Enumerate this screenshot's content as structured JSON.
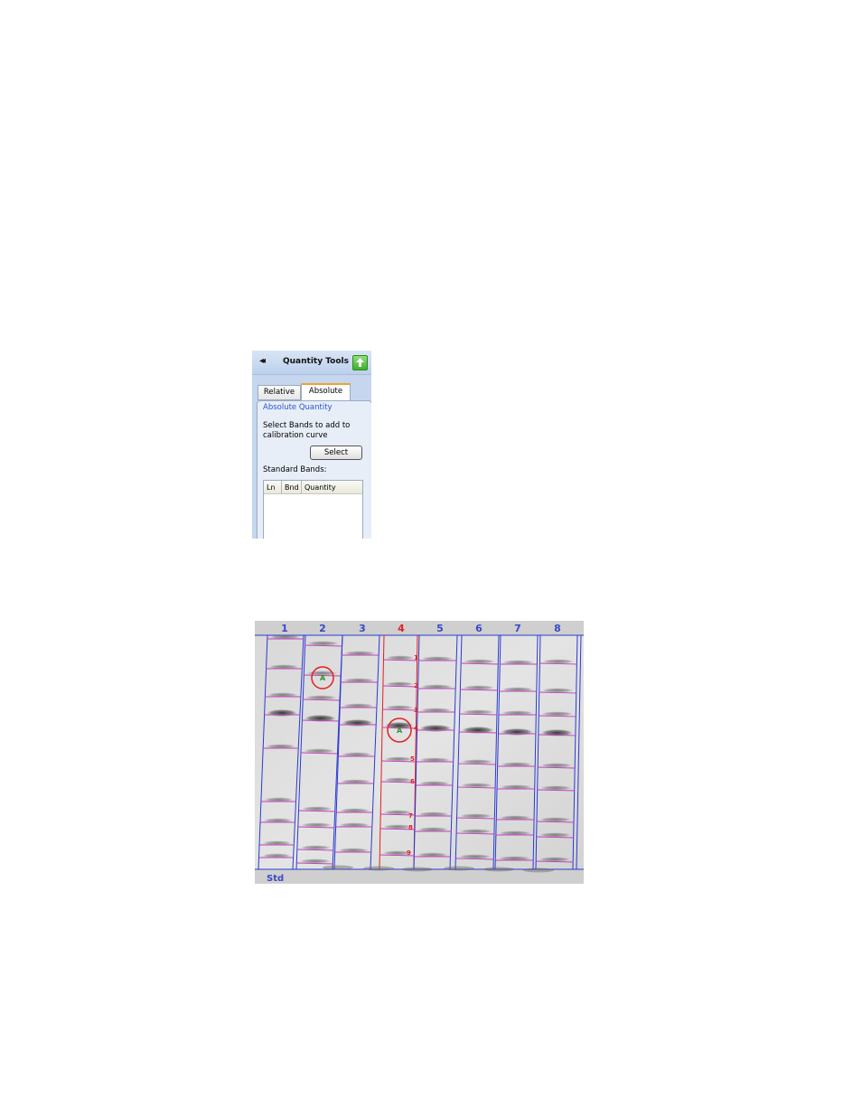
{
  "panel": {
    "title": "Quantity Tools",
    "collapse_glyph": "◂◂",
    "tabs": [
      {
        "label": "Relative",
        "selected": false
      },
      {
        "label": "Absolute",
        "selected": true
      }
    ],
    "section_title": "Absolute Quantity",
    "instructions": "Select Bands to add to calibration curve",
    "select_button": "Select",
    "standard_bands_label": "Standard Bands:",
    "table_columns": [
      "Ln",
      "Bnd",
      "Quantity"
    ],
    "icons": {
      "collapse": "double-chevron-left-icon",
      "upload": "green-up-arrow-icon"
    }
  },
  "gel": {
    "lanes": [
      "1",
      "2",
      "3",
      "4",
      "5",
      "6",
      "7",
      "8"
    ],
    "selected_lane": "4",
    "band_numbers": [
      "1",
      "2",
      "3",
      "4",
      "5",
      "6",
      "7",
      "8",
      "9"
    ],
    "std_label": "Std",
    "marker_label": "A",
    "colors": {
      "lane_lines": "#2b3bd0",
      "selected_lane": "#e02020",
      "band_marks": "#c040c0",
      "marker_fill": "#2a9a2a"
    }
  }
}
